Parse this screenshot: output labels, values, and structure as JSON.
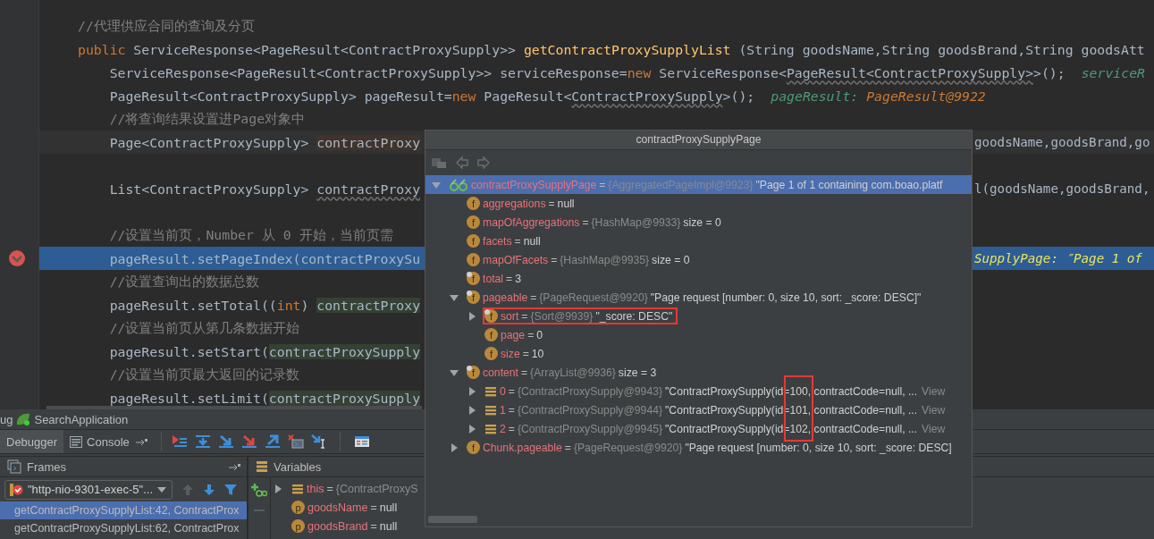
{
  "editor": {
    "lines": [
      {
        "kind": "code",
        "segments": [
          {
            "kind": "comment",
            "text": "//代理供应合同的查询及分页"
          }
        ]
      },
      {
        "kind": "code",
        "segments": [
          {
            "kind": "keyword",
            "text": "public"
          },
          {
            "kind": "plain",
            "text": " ServiceResponse<PageResult<ContractProxySupply>> "
          },
          {
            "kind": "method",
            "text": "getContractProxySupplyList"
          },
          {
            "kind": "plain",
            "text": " (String goodsName,String goodsBrand,String goodsAtt"
          }
        ]
      },
      {
        "kind": "code",
        "segments": [
          {
            "kind": "plain",
            "text": "    ServiceResponse<PageResult<ContractProxySupply>> serviceResponse="
          },
          {
            "kind": "keyword",
            "text": "new"
          },
          {
            "kind": "plain",
            "text": " ServiceResponse<"
          },
          {
            "kind": "squiggle",
            "text": "PageResult<ContractProxySupply>"
          },
          {
            "kind": "plain",
            "text": ">();"
          },
          {
            "kind": "hint",
            "text": "serviceR"
          }
        ]
      },
      {
        "kind": "code",
        "segments": [
          {
            "kind": "plain",
            "text": "    PageResult<ContractProxySupply> pageResult="
          },
          {
            "kind": "keyword",
            "text": "new"
          },
          {
            "kind": "plain",
            "text": " PageResult<"
          },
          {
            "kind": "squiggle",
            "text": "ContractProxySupply"
          },
          {
            "kind": "plain",
            "text": ">();"
          },
          {
            "kind": "hint",
            "text": "pageResult: "
          },
          {
            "kind": "hint_value",
            "text": "PageResult@9922"
          }
        ]
      },
      {
        "kind": "code",
        "segments": [
          {
            "kind": "comment",
            "text": "    //将查询结果设置进Page对象中"
          }
        ]
      },
      {
        "kind": "code",
        "current": true,
        "segments": [
          {
            "kind": "plain",
            "text": "    Page<ContractProxySupply> "
          },
          {
            "kind": "write_usage",
            "text": "contractProxy"
          }
        ],
        "tail": [
          {
            "kind": "plain",
            "text": "goodsName,goodsBrand,go"
          }
        ]
      },
      {
        "kind": "blank"
      },
      {
        "kind": "code",
        "segments": [
          {
            "kind": "plain",
            "text": "    List<ContractProxySupply> "
          },
          {
            "kind": "squiggle",
            "text": "contractProxy"
          }
        ],
        "tail": [
          {
            "kind": "plain",
            "text": "l(goodsName,goodsBrand,"
          }
        ]
      },
      {
        "kind": "blank"
      },
      {
        "kind": "code",
        "segments": [
          {
            "kind": "comment",
            "text": "    //设置当前页，Number 从 0 开始，当前页需"
          }
        ]
      },
      {
        "kind": "code",
        "paused": true,
        "segments": [
          {
            "kind": "plain",
            "text": "    pageResult.setPageIndex(contractProxySu"
          }
        ],
        "tail": [
          {
            "kind": "debug_hint",
            "text": "SupplyPage: ″Page 1 of"
          }
        ]
      },
      {
        "kind": "code",
        "segments": [
          {
            "kind": "comment",
            "text": "    //设置查询出的数据总数"
          }
        ]
      },
      {
        "kind": "code",
        "segments": [
          {
            "kind": "plain",
            "text": "    pageResult.setTotal(("
          },
          {
            "kind": "keyword",
            "text": "int"
          },
          {
            "kind": "plain",
            "text": ") "
          },
          {
            "kind": "read_usage",
            "text": "contractProxy"
          }
        ]
      },
      {
        "kind": "code",
        "segments": [
          {
            "kind": "comment",
            "text": "    //设置当前页从第几条数据开始"
          }
        ]
      },
      {
        "kind": "code",
        "segments": [
          {
            "kind": "plain",
            "text": "    pageResult.setStart("
          },
          {
            "kind": "read_usage",
            "text": "contractProxySupply"
          }
        ]
      },
      {
        "kind": "code",
        "segments": [
          {
            "kind": "comment",
            "text": "    //设置当前页最大返回的记录数"
          }
        ]
      },
      {
        "kind": "code",
        "segments": [
          {
            "kind": "plain",
            "text": "    pageResult.setLimit("
          },
          {
            "kind": "read_usage",
            "text": "contractProxySupply"
          }
        ]
      }
    ]
  },
  "popup": {
    "title": "contractProxySupplyPage",
    "tree": [
      {
        "kind": "watch",
        "name": "contractProxySupplyPage",
        "sep": "=",
        "type": "{AggregatedPageImpl@9923}",
        "value": "\"Page 1 of 1 containing com.boao.platf",
        "selected": true,
        "expanded": true,
        "children": [
          {
            "kind": "field",
            "badge": "f",
            "final": false,
            "name": "aggregations",
            "sep": "=",
            "value": "null",
            "selected": false
          },
          {
            "kind": "field",
            "badge": "f",
            "final": false,
            "name": "mapOfAggregations",
            "sep": "=",
            "type": "{HashMap@9933}",
            "value": "size = 0",
            "selected": false
          },
          {
            "kind": "field",
            "badge": "f",
            "final": false,
            "name": "facets",
            "sep": "=",
            "value": "null",
            "selected": false
          },
          {
            "kind": "field",
            "badge": "f",
            "final": false,
            "name": "mapOfFacets",
            "sep": "=",
            "type": "{HashMap@9935}",
            "value": "size = 0",
            "selected": false
          },
          {
            "kind": "field",
            "badge": "f",
            "final": true,
            "name": "total",
            "sep": "=",
            "value": "3",
            "selected": false
          },
          {
            "kind": "field",
            "badge": "f",
            "final": true,
            "name": "pageable",
            "sep": "=",
            "type": "{PageRequest@9920}",
            "value": "\"Page request [number: 0, size 10, sort: _score: DESC]\"",
            "selected": false,
            "expanded": true,
            "children": [
              {
                "kind": "field",
                "badge": "f",
                "final": true,
                "name": "sort",
                "sep": "=",
                "type": "{Sort@9939}",
                "value": "\"_score: DESC\"",
                "selected": false,
                "expanded": false,
                "annotated": true
              },
              {
                "kind": "field",
                "badge": "f",
                "final": false,
                "name": "page",
                "sep": "=",
                "value": "0",
                "selected": false
              },
              {
                "kind": "field",
                "badge": "f",
                "final": false,
                "name": "size",
                "sep": "=",
                "value": "10",
                "selected": false
              }
            ]
          },
          {
            "kind": "field",
            "badge": "f",
            "final": true,
            "name": "content",
            "sep": "=",
            "type": "{ArrayList@9936}",
            "value": "size = 3",
            "selected": false,
            "expanded": true,
            "children": [
              {
                "kind": "element",
                "name": "0",
                "sep": "=",
                "type": "{ContractProxySupply@9943}",
                "value": "\"ContractProxySupply(id=100, contractCode=null, ...",
                "link": "View",
                "selected": false,
                "expanded": false
              },
              {
                "kind": "element",
                "name": "1",
                "sep": "=",
                "type": "{ContractProxySupply@9944}",
                "value": "\"ContractProxySupply(id=101, contractCode=null, ...",
                "link": "View",
                "selected": false,
                "expanded": false
              },
              {
                "kind": "element",
                "name": "2",
                "sep": "=",
                "type": "{ContractProxySupply@9945}",
                "value": "\"ContractProxySupply(id=102, contractCode=null, ...",
                "link": "View",
                "selected": false,
                "expanded": false
              }
            ]
          },
          {
            "kind": "field",
            "badge": "f",
            "final": false,
            "name": "Chunk.pageable",
            "sep": "=",
            "type": "{PageRequest@9920}",
            "value": "\"Page request [number: 0, size 10, sort: _score: DESC]",
            "selected": false,
            "expanded": false
          }
        ]
      }
    ]
  },
  "debug_panel": {
    "title_prefix": "ug",
    "app": "SearchApplication",
    "tabs": [
      {
        "label": "Debugger",
        "selected": true
      },
      {
        "label": "Console",
        "selected": false
      }
    ],
    "frames": {
      "title": "Frames",
      "thread": "\"http-nio-9301-exec-5\"...",
      "items": [
        {
          "text": "getContractProxySupplyList:42, ContractProx",
          "selected": true
        },
        {
          "text": "getContractProxySupplyList:62, ContractProx",
          "selected": false
        }
      ]
    },
    "variables": {
      "title": "Variables",
      "items": [
        {
          "kind": "element",
          "name": "this",
          "sep": "=",
          "type": "{ContractProxyS",
          "expanded": false
        },
        {
          "kind": "field",
          "badge": "p",
          "name": "goodsName",
          "sep": "=",
          "value": "null"
        },
        {
          "kind": "field",
          "badge": "p",
          "name": "goodsBrand",
          "sep": "=",
          "value": "null"
        }
      ]
    }
  }
}
